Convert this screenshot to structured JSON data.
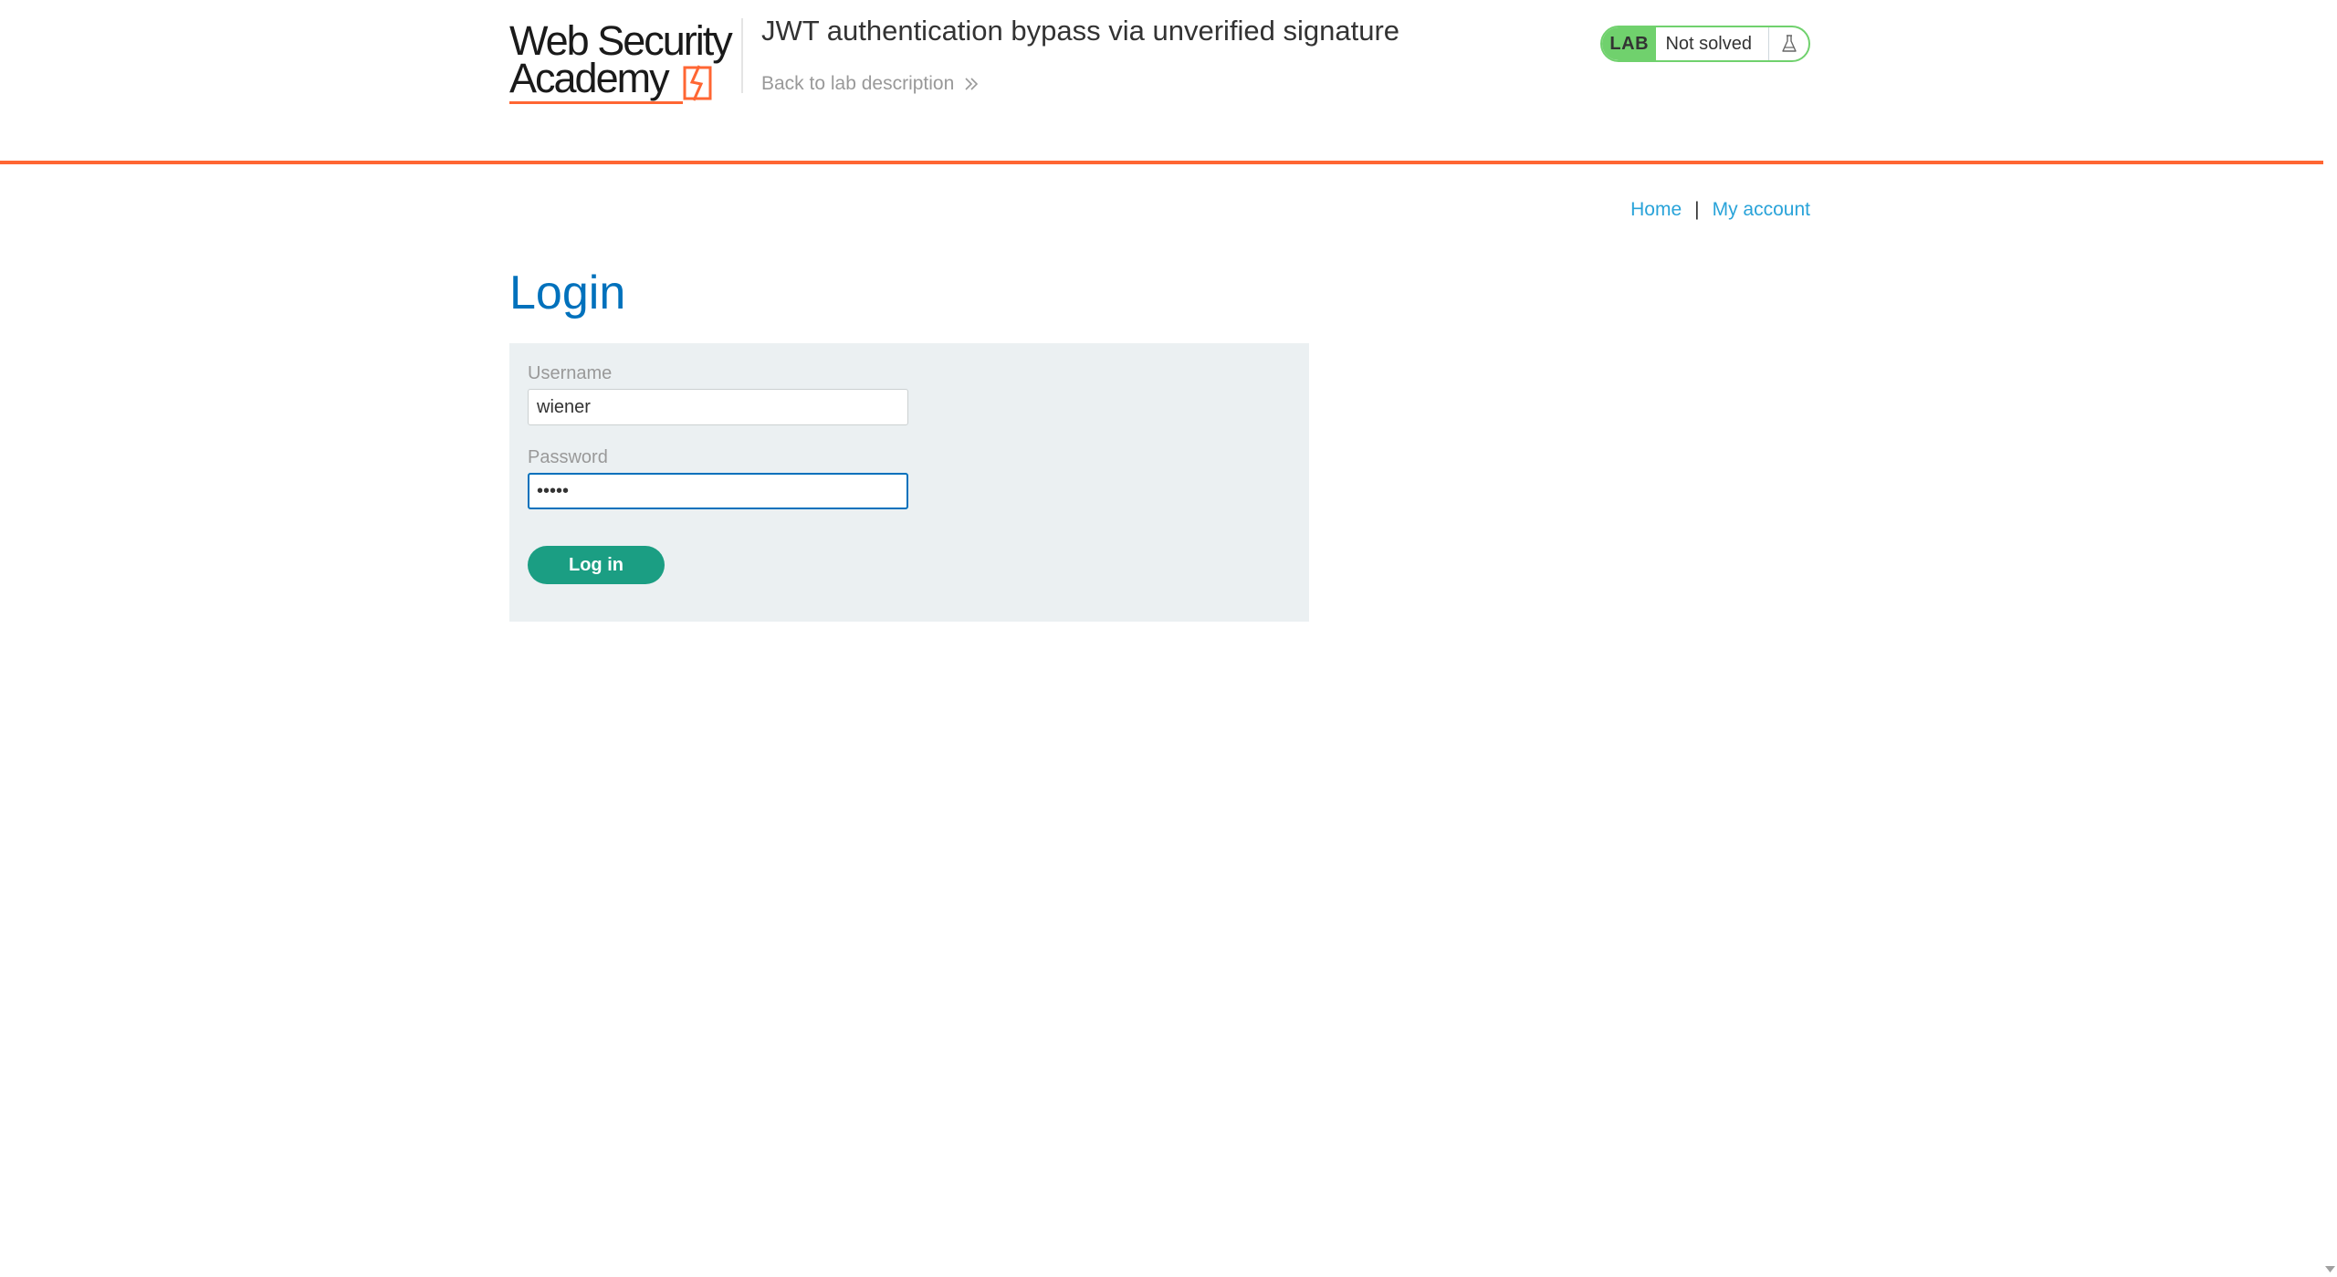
{
  "header": {
    "logo": {
      "line1": "Web Security",
      "line2": "Academy"
    },
    "lab_title": "JWT authentication bypass via unverified signature",
    "back_link": "Back to lab description",
    "status": {
      "tag": "LAB",
      "text": "Not solved",
      "icon": "flask-icon"
    }
  },
  "nav": {
    "home": "Home",
    "separator": "|",
    "my_account": "My account"
  },
  "login": {
    "heading": "Login",
    "username_label": "Username",
    "username_value": "wiener",
    "password_label": "Password",
    "password_value": "peter",
    "submit_label": "Log in"
  },
  "colors": {
    "accent_orange": "#ff6633",
    "heading_blue": "#0071bc",
    "link_blue": "#29a3d9",
    "button_green": "#1b9e83",
    "status_green": "#70d16d",
    "panel_bg": "#ebf0f2"
  }
}
